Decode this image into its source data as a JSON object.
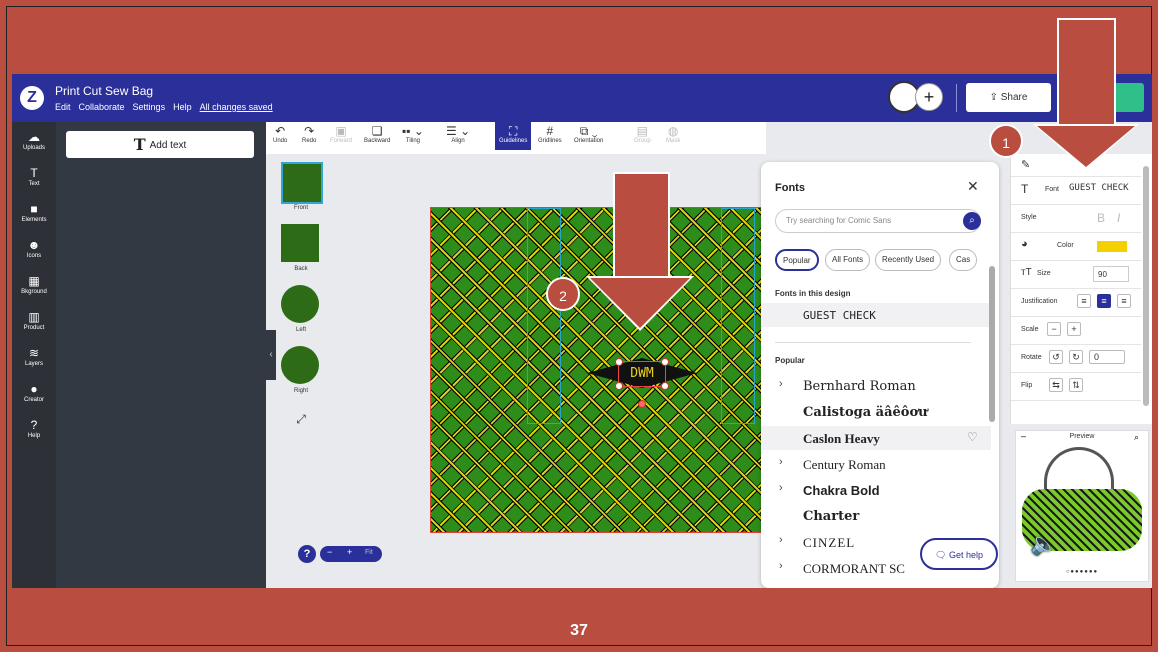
{
  "app": {
    "title": "Print Cut Sew Bag",
    "menu": [
      "Edit",
      "Collaborate",
      "Settings",
      "Help"
    ],
    "saved_status": "All changes saved",
    "share_label": "Share"
  },
  "left_rail": [
    {
      "label": "Uploads",
      "icon": "cloud-upload-icon"
    },
    {
      "label": "Text",
      "icon": "text-icon"
    },
    {
      "label": "Elements",
      "icon": "shapes-icon"
    },
    {
      "label": "Icons",
      "icon": "smiley-icon"
    },
    {
      "label": "Bkground",
      "icon": "background-icon"
    },
    {
      "label": "Product",
      "icon": "product-icon"
    },
    {
      "label": "Layers",
      "icon": "layers-icon"
    },
    {
      "label": "Creator",
      "icon": "creator-avatar-icon"
    },
    {
      "label": "Help",
      "icon": "help-icon"
    }
  ],
  "panel": {
    "add_text_label": "Add text"
  },
  "toolbar": [
    {
      "label": "Undo",
      "icon": "undo-icon",
      "enabled": true
    },
    {
      "label": "Redo",
      "icon": "redo-icon",
      "enabled": true
    },
    {
      "label": "Forward",
      "icon": "forward-icon",
      "enabled": false
    },
    {
      "label": "Backward",
      "icon": "backward-icon",
      "enabled": true
    },
    {
      "label": "Tiling",
      "icon": "tiling-icon",
      "enabled": true
    },
    {
      "label": "Align",
      "icon": "align-icon",
      "enabled": true
    },
    {
      "label": "Guidelines",
      "icon": "guidelines-icon",
      "enabled": true,
      "active": true
    },
    {
      "label": "Gridlines",
      "icon": "gridlines-icon",
      "enabled": true
    },
    {
      "label": "Orientation",
      "icon": "orientation-icon",
      "enabled": true
    },
    {
      "label": "Group",
      "icon": "group-icon",
      "enabled": false
    },
    {
      "label": "Mask",
      "icon": "mask-icon",
      "enabled": false
    }
  ],
  "thumbnails": [
    "Front",
    "Back",
    "Left",
    "Right"
  ],
  "canvas": {
    "design_text": "DWM"
  },
  "zoom": {
    "minus": "−",
    "plus": "+",
    "fit": "Fit"
  },
  "fonts_panel": {
    "title": "Fonts",
    "search_placeholder": "Try searching for Comic Sans",
    "chips": [
      "Popular",
      "All Fonts",
      "Recently Used",
      "Cas"
    ],
    "in_design_heading": "Fonts in this design",
    "in_design": [
      "GUEST CHECK"
    ],
    "popular_heading": "Popular",
    "popular": [
      {
        "name": "Bernhard Roman",
        "expandable": true
      },
      {
        "name": "Calistoga äâêôơư",
        "expandable": false
      },
      {
        "name": "Caslon Heavy",
        "expandable": false,
        "favorite": true
      },
      {
        "name": "Century Roman",
        "expandable": true
      },
      {
        "name": "Chakra Bold",
        "expandable": true
      },
      {
        "name": "Charter",
        "expandable": false
      },
      {
        "name": "CINZEL",
        "expandable": true
      },
      {
        "name": "CORMORANT SC",
        "expandable": true
      }
    ],
    "get_help": "Get help"
  },
  "properties": {
    "font_label": "Font",
    "font_value": "GUEST CHECK",
    "style_label": "Style",
    "style_bold": "B",
    "style_italic": "I",
    "color_label": "Color",
    "color_value": "#f5d000",
    "size_label": "Size",
    "size_value": "90",
    "justification_label": "Justification",
    "scale_label": "Scale",
    "rotate_label": "Rotate",
    "rotate_value": "0",
    "flip_label": "Flip"
  },
  "preview": {
    "title": "Preview",
    "dots": "○●●●●●●"
  },
  "annotations": {
    "step1": "1",
    "step2": "2"
  },
  "slide_number": "37"
}
